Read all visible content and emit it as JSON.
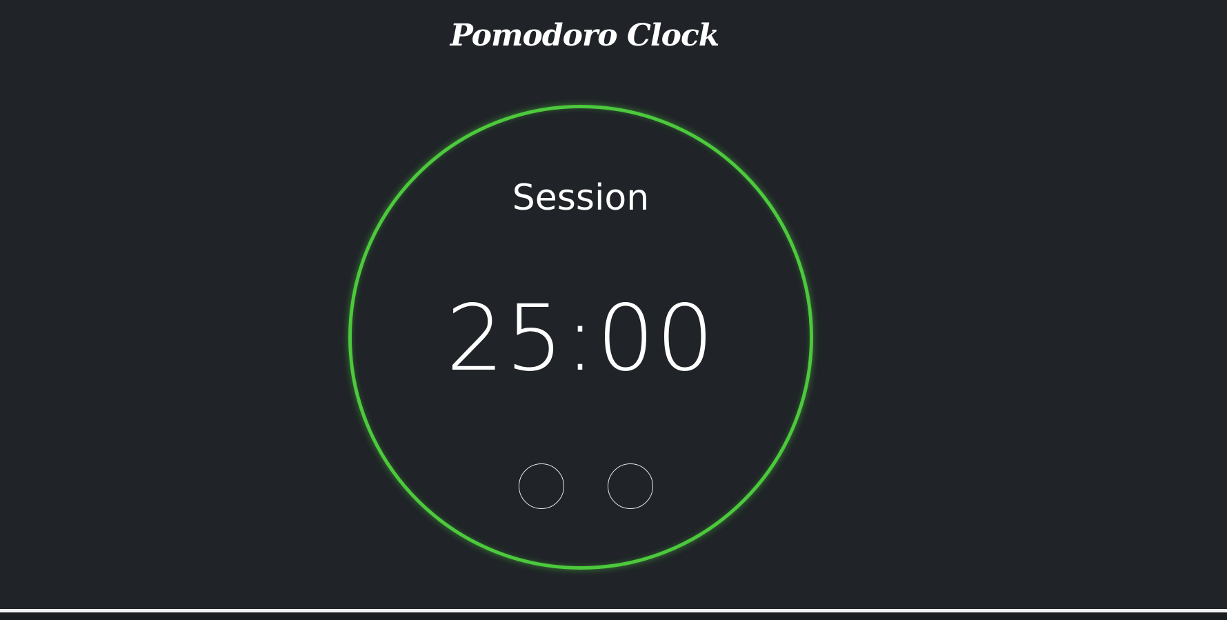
{
  "app": {
    "title": "Pomodoro Clock"
  },
  "clock": {
    "mode_label": "Session",
    "time_display": "25:00"
  },
  "colors": {
    "background": "#202428",
    "ring": "#4cc93c",
    "text": "#ffffff",
    "control_outline": "#e6e6e6"
  },
  "controls": [
    {
      "name": "left-circle-button",
      "label": ""
    },
    {
      "name": "right-circle-button",
      "label": ""
    }
  ]
}
